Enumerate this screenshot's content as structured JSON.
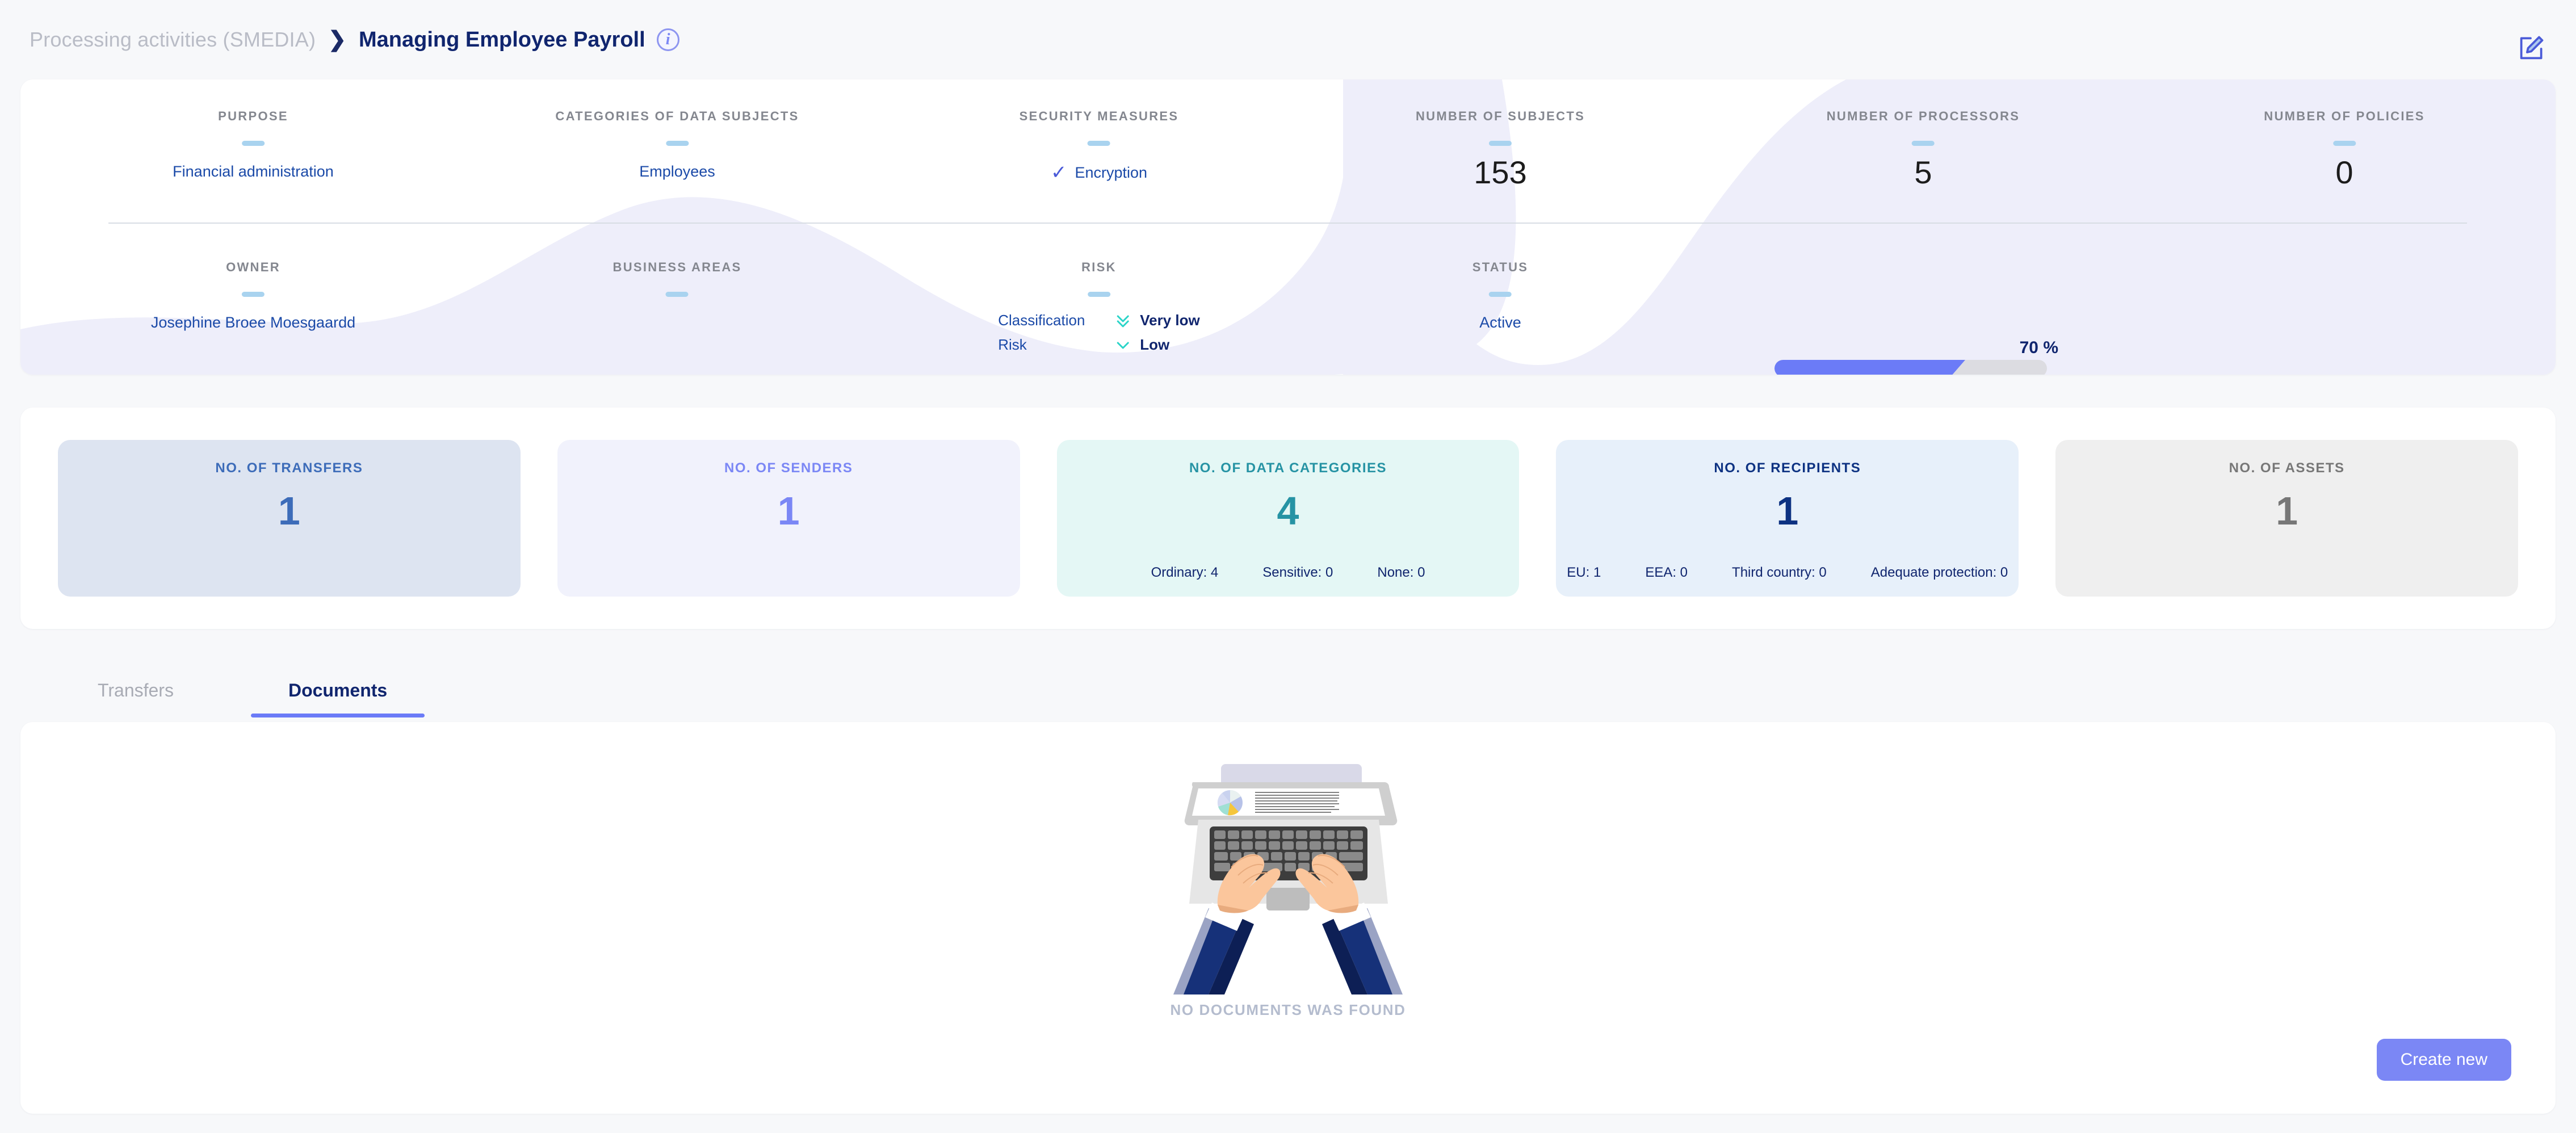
{
  "breadcrumb": {
    "parent": "Processing activities (SMEDIA)",
    "separator": "❯",
    "current": "Managing Employee Payroll",
    "info_icon": "info-icon",
    "edit_icon": "edit-pencil-icon"
  },
  "summary": {
    "row1": [
      {
        "label": "PURPOSE",
        "value": "Financial administration",
        "type": "text"
      },
      {
        "label": "CATEGORIES OF DATA SUBJECTS",
        "value": "Employees",
        "type": "text"
      },
      {
        "label": "SECURITY MEASURES",
        "value": "Encryption",
        "type": "check",
        "check_glyph": "✓"
      },
      {
        "label": "NUMBER OF SUBJECTS",
        "value": "153",
        "type": "number"
      },
      {
        "label": "NUMBER OF PROCESSORS",
        "value": "5",
        "type": "number"
      },
      {
        "label": "NUMBER OF POLICIES",
        "value": "0",
        "type": "number"
      }
    ],
    "row2": [
      {
        "label": "OWNER",
        "value": "Josephine Broee Moesgaardd",
        "type": "text"
      },
      {
        "label": "BUSINESS AREAS",
        "value": "",
        "type": "text"
      },
      {
        "label": "RISK",
        "type": "risk"
      },
      {
        "label": "STATUS",
        "value": "Active",
        "type": "text"
      }
    ],
    "risk": {
      "rows": [
        {
          "label": "Classification",
          "value": "Very low",
          "chevron": "double-chevron-down-icon"
        },
        {
          "label": "Risk",
          "value": "Low",
          "chevron": "chevron-down-icon"
        }
      ],
      "chevron_color": "#2ad4c8"
    },
    "progress": {
      "percent_label": "70 %",
      "percent": 70,
      "fill_color": "#6b7bf7",
      "track_color": "#dcdce1"
    },
    "accent_dash_color": "#a9d3ef",
    "wave_color": "#eeeefa"
  },
  "stat_cards": [
    {
      "title": "NO. OF TRANSFERS",
      "value": "1",
      "bg": "#dde4f1",
      "fg": "#3d6cb9",
      "subs": []
    },
    {
      "title": "NO. OF SENDERS",
      "value": "1",
      "bg": "#f1f2fc",
      "fg": "#7b87f5",
      "subs": []
    },
    {
      "title": "NO. OF DATA CATEGORIES",
      "value": "4",
      "bg": "#e4f7f5",
      "fg": "#2693a4",
      "subs": [
        "Ordinary: 4",
        "Sensitive: 0",
        "None: 0"
      ]
    },
    {
      "title": "NO. OF RECIPIENTS",
      "value": "1",
      "bg": "#e7f0fa",
      "fg": "#0d3282",
      "subs": [
        "EU: 1",
        "EEA: 0",
        "Third country: 0",
        "Adequate protection: 0"
      ]
    },
    {
      "title": "NO. OF ASSETS",
      "value": "1",
      "bg": "#efefef",
      "fg": "#777777",
      "subs": []
    }
  ],
  "tabs": [
    {
      "label": "Transfers",
      "active": false
    },
    {
      "label": "Documents",
      "active": true
    }
  ],
  "empty_state": {
    "illustration": "person-typing-on-laptop-illustration",
    "message": "NO DOCUMENTS WAS FOUND"
  },
  "actions": {
    "create_new": "Create new"
  }
}
